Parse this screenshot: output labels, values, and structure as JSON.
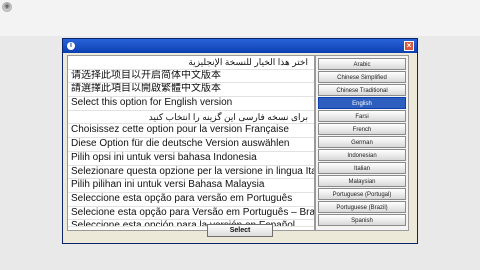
{
  "dialog": {
    "lines": [
      "اختر هذا الخيار للنسخة الإنجليزية",
      "请选择此项目以开启简体中文版本",
      "請選擇此項目以開啟繁體中文版本",
      "Select this option for English version",
      "برای نسخه فارسی این گزینه را انتخاب کنید",
      "Choisissez cette option pour la version Française",
      "Diese Option für die deutsche Version auswählen",
      "Pilih opsi ini untuk versi bahasa Indonesia",
      "Selezionare questa opzione per la versione in lingua Italiana",
      "Pilih pilihan ini untuk versi Bahasa Malaysia",
      "Seleccione esta opção para versão em Português",
      "Selecione esta opção para Versão em Português – Brasil",
      "Seleccione esta opción para la versión en Español"
    ],
    "languages": [
      "Arabic",
      "Chinese Simplified",
      "Chinese Traditional",
      "English",
      "Farsi",
      "French",
      "German",
      "Indonesian",
      "Italian",
      "Malaysian",
      "Portuguese (Portugal)",
      "Portuguese (Brazil)",
      "Spanish"
    ],
    "selected_language": "English",
    "select_label": "Select",
    "close_glyph": "×"
  }
}
